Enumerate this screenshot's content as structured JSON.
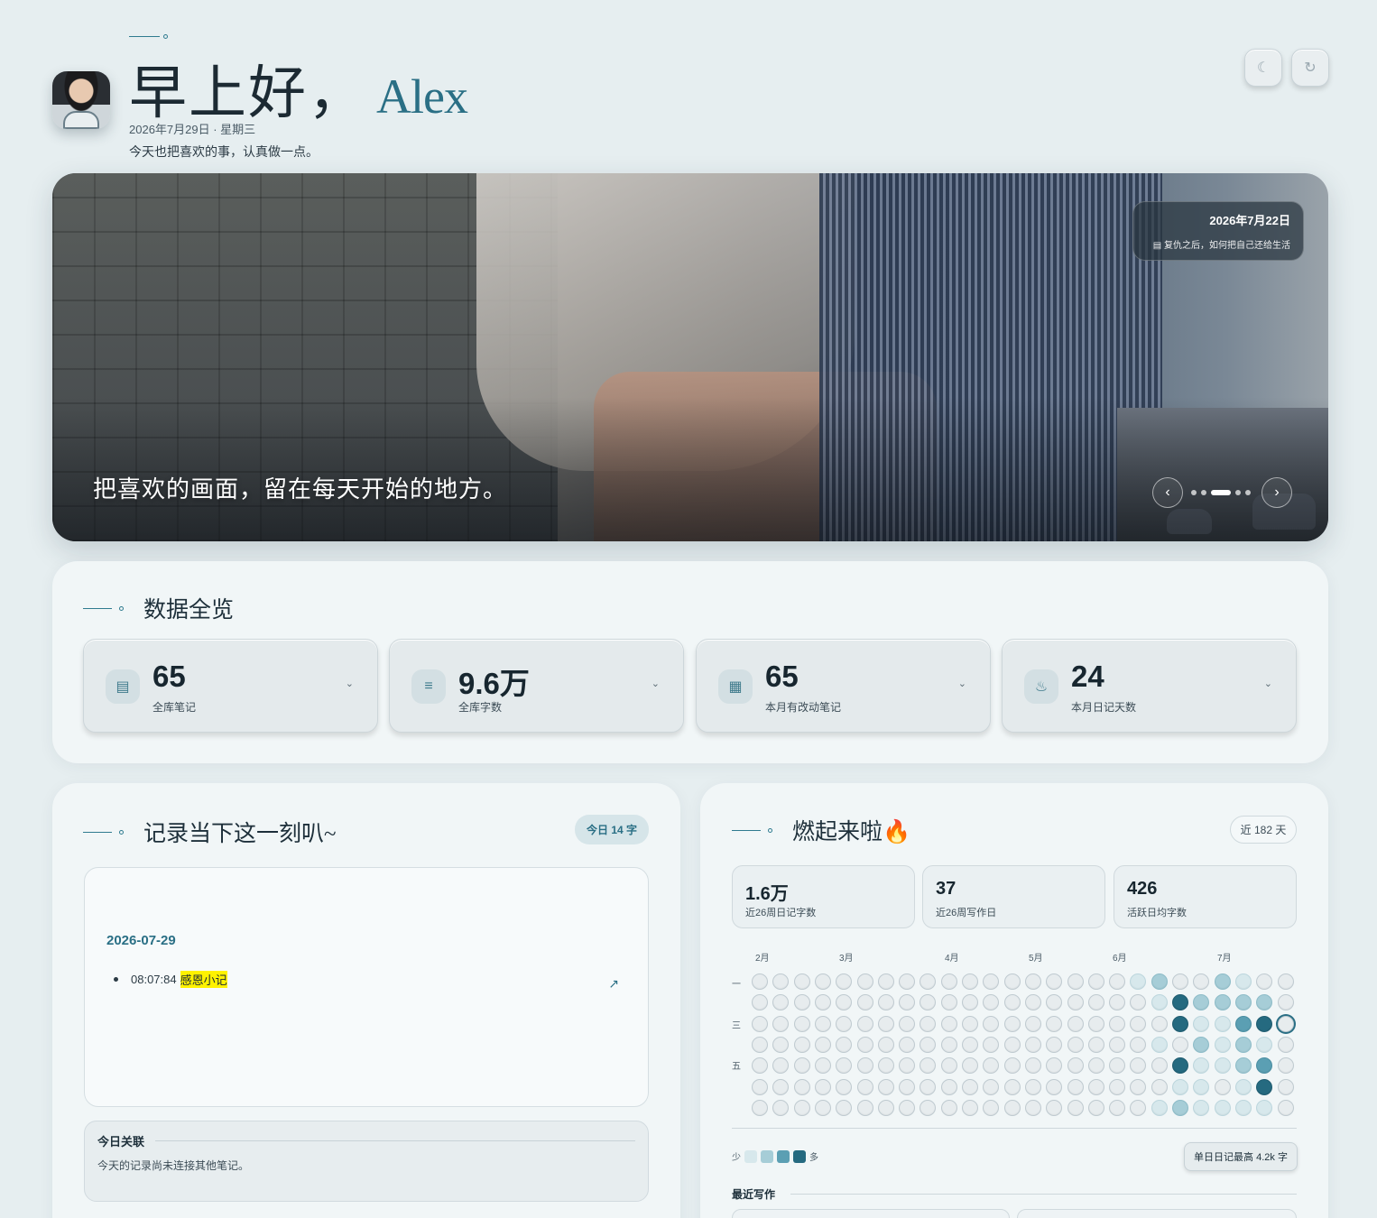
{
  "header": {
    "greeting": "早上好，",
    "name": "Alex",
    "date": "2026年7月29日 · 星期三",
    "motto": "今天也把喜欢的事，认真做一点。",
    "buttons": {
      "theme_icon": "moon-icon",
      "refresh_icon": "refresh-icon"
    }
  },
  "hero": {
    "caption": "把喜欢的画面，留在每天开始的地方。",
    "card_date": "2026年7月22日",
    "card_title": "复仇之后，如何把自己还给生活",
    "prev": "‹",
    "next": "›",
    "slides_total": 5,
    "slide_active": 3
  },
  "overview": {
    "title": "数据全览",
    "stats": [
      {
        "icon": "document-icon",
        "value": "65",
        "label": "全库笔记"
      },
      {
        "icon": "text-lines-icon",
        "value": "9.6万",
        "label": "全库字数"
      },
      {
        "icon": "calendar-icon",
        "value": "65",
        "label": "本月有改动笔记"
      },
      {
        "icon": "flame-icon",
        "value": "24",
        "label": "本月日记天数"
      }
    ]
  },
  "record": {
    "title": "记录当下这一刻叭~",
    "today_badge": "今日 14 字",
    "note_date": "2026-07-29",
    "note_time": "08:07:84",
    "note_link": "感恩小记",
    "related_title": "今日关联",
    "related_text": "今天的记录尚未连接其他笔记。"
  },
  "streak": {
    "title": "燃起来啦🔥",
    "range_badge": "近 182 天",
    "minis": [
      {
        "value": "1.6万",
        "label": "近26周日记字数"
      },
      {
        "value": "37",
        "label": "近26周写作日"
      },
      {
        "value": "426",
        "label": "活跃日均字数"
      }
    ],
    "months": [
      "2月",
      "3月",
      "4月",
      "5月",
      "6月",
      "7月"
    ],
    "weekdays": [
      "一",
      "三",
      "五"
    ],
    "legend_less": "少",
    "legend_more": "多",
    "legend_colors": [
      "#d7e8ec",
      "#a6cdd7",
      "#5b9fb3",
      "#256a80"
    ],
    "max_badge": "单日日记最高 4.2k 字",
    "recent_title": "最近写作",
    "heat_cols": [
      [
        1,
        0,
        0,
        0,
        0,
        0,
        0
      ],
      [
        2,
        1,
        0,
        1,
        0,
        0,
        1
      ],
      [
        0,
        4,
        4,
        0,
        4,
        1,
        2
      ],
      [
        0,
        2,
        1,
        2,
        1,
        1,
        1
      ],
      [
        2,
        2,
        1,
        1,
        1,
        0,
        1
      ],
      [
        1,
        2,
        3,
        2,
        2,
        1,
        1
      ],
      [
        0,
        2,
        4,
        1,
        3,
        4,
        1
      ],
      [
        0,
        0,
        0,
        0,
        0,
        0,
        0
      ]
    ]
  }
}
